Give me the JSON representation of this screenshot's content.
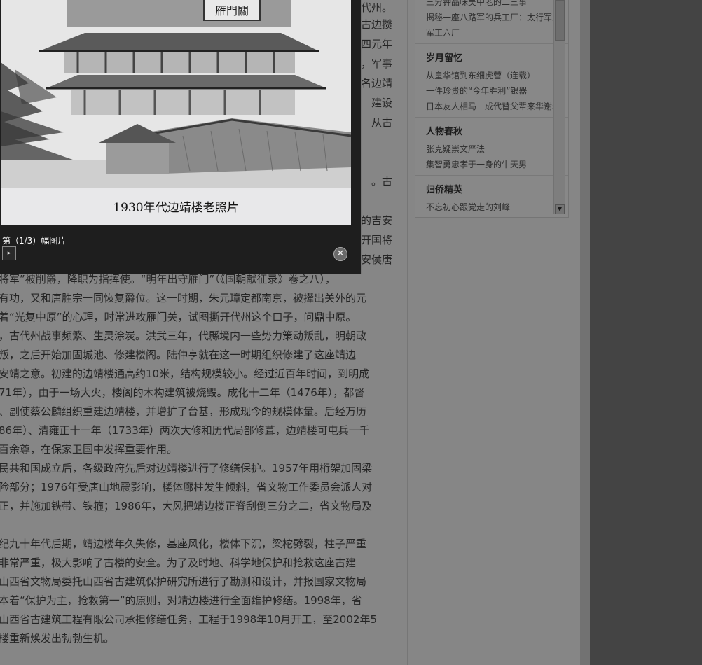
{
  "photo": {
    "caption": "1930年代边靖楼老照片",
    "sign": "雁門關"
  },
  "viewer": {
    "counter": "第（1/3）幅图片",
    "next_icon": "▸",
    "close_icon": "✕"
  },
  "sidebar": {
    "top_links": [
      "三分钟品味吴中老的二三事",
      "揭秘一座八路军的兵工厂：太行军工",
      "军工六厂"
    ],
    "sections": [
      {
        "title": "岁月留忆",
        "links": [
          "从皇华馆到东细虎营（连载）",
          "一件珍贵的“今年胜利”银器",
          "日本友人相马一成代替父辈来华谢罪"
        ]
      },
      {
        "title": "人物春秋",
        "links": [
          "张克疑崇文严法",
          "集智勇忠孝于一身的牛天男"
        ]
      },
      {
        "title": "归侨精英",
        "links": [
          "不忘初心跟党走的刘峰"
        ]
      }
    ]
  },
  "article": {
    "lines": [
      "代州。",
      "古边攒",
      "四元年",
      "，军事",
      "名边靖",
      "建设",
      "从古",
      "。古",
      "的吉安",
      "开国将",
      "安侯唐",
      "将军”被削爵，降职为指挥使。“明年出守雁门”（《国朝献征录》卷之八），",
      "有功，又和唐胜宗一同恢复爵位。这一时期，朱元璋定都南京，被撵出关外的元",
      "着“光复中原”的心理，时常进攻雁门关，试图撕开代州这个口子，问鼎中原。",
      "，古代州战事频繁、生灵涂炭。洪武三年，代縣境内一些势力策动叛乱，明朝政",
      "叛，之后开始加固城池、修建楼阁。陆仲亨就在这一时期组织修建了这座靖边",
      "安靖之意。初建的边靖楼通高约10米，结构规模较小。经过近百年时间，到明成",
      "71年），由于一场大火，楼阁的木构建筑被烧毁。成化十二年（1476年），都督",
      "、副使蔡公麟组织重建边靖楼，并增扩了台基，形成现今的规模体量。后经万历",
      "86年）、清雍正十一年（1733年）两次大修和历代局部修葺，边靖楼可屯兵一千",
      "百余尊，在保家卫国中发挥重要作用。",
      "民共和国成立后，各级政府先后对边靖楼进行了修缮保护。1957年用桁架加固梁",
      "险部分；1976年受唐山地震影响，楼体廊柱发生倾斜，省文物工作委员会派人对",
      "正，并施加铁带、铁箍；1986年，大风把靖边楼正脊刮倒三分之二，省文物局及",
      "",
      "纪九十年代后期，靖边楼年久失修，基座风化，楼体下沉，梁柁劈裂，柱子严重",
      "非常严重，极大影响了古楼的安全。为了及时地、科学地保护和抢救这座古建",
      "山西省文物局委托山西省古建筑保护研究所进行了勘测和设计，并报国家文物局",
      "本着“保护为主，抢救第一”的原则，对靖边楼进行全面维护修缮。1998年，省",
      "山西省古建筑工程有限公司承担修缮任务，工程于1998年10月开工，至2002年5",
      "楼重新焕发出勃勃生机。"
    ]
  }
}
